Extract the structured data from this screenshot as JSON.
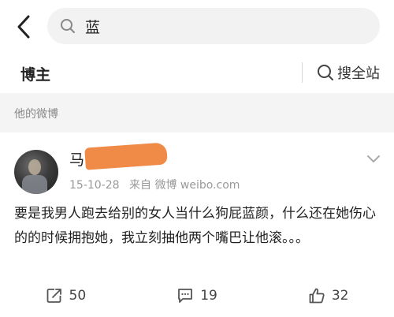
{
  "search": {
    "query": "蓝"
  },
  "tabs": {
    "blogger_title": "博主",
    "search_all": "搜全站"
  },
  "section": {
    "title": "他的微博"
  },
  "post": {
    "username_visible": "马",
    "date": "15-10-28",
    "source": "来自 微博 weibo.com",
    "text": "要是我男人跑去给别的女人当什么狗屁蓝颜，什么还在她伤心的的时候拥抱她，我立刻抽他两个嘴巴让他滚。。。",
    "reposts": "50",
    "comments": "19",
    "likes": "32"
  },
  "icons": {
    "back": "chevron-left-icon",
    "search": "search-icon",
    "more": "chevron-down-icon",
    "repost": "repost-icon",
    "comment": "comment-icon",
    "like": "thumbs-up-icon"
  },
  "colors": {
    "redaction": "#f08a47",
    "section_bg": "#f4f4f4",
    "search_bg": "#f2f2f2"
  }
}
